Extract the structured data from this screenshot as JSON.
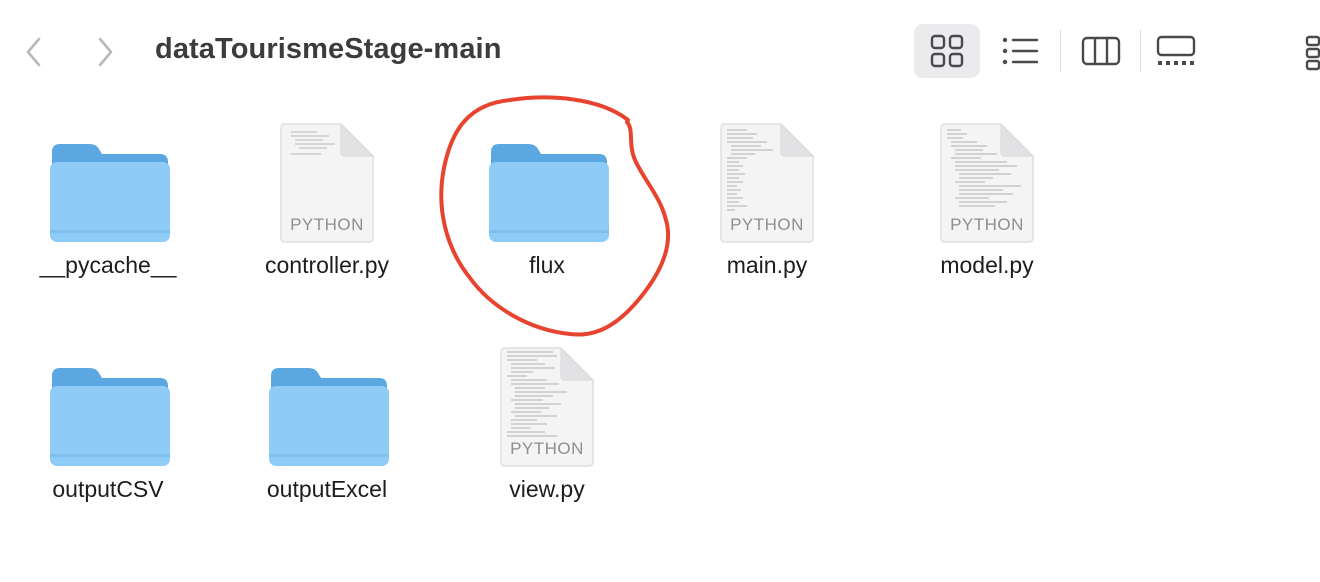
{
  "window": {
    "title": "dataTourismeStage-main"
  },
  "toolbar": {
    "back_icon": "chevron-left-icon",
    "forward_icon": "chevron-right-icon",
    "views": [
      {
        "name": "icons",
        "icon": "grid-icon",
        "selected": true
      },
      {
        "name": "list",
        "icon": "list-icon",
        "selected": false
      },
      {
        "name": "columns",
        "icon": "columns-icon",
        "selected": false
      },
      {
        "name": "gallery",
        "icon": "gallery-icon",
        "selected": false
      },
      {
        "name": "group",
        "icon": "group-icon",
        "selected": false
      }
    ]
  },
  "items": [
    {
      "name": "__pycache__",
      "kind": "folder"
    },
    {
      "name": "controller.py",
      "kind": "python-file",
      "badge": "PYTHON"
    },
    {
      "name": "flux",
      "kind": "folder",
      "annotated": true
    },
    {
      "name": "main.py",
      "kind": "python-file",
      "badge": "PYTHON"
    },
    {
      "name": "model.py",
      "kind": "python-file",
      "badge": "PYTHON"
    },
    {
      "name": "outputCSV",
      "kind": "folder"
    },
    {
      "name": "outputExcel",
      "kind": "folder"
    },
    {
      "name": "view.py",
      "kind": "python-file",
      "badge": "PYTHON"
    }
  ],
  "colors": {
    "folder_front": "#8ecbf6",
    "folder_back": "#5aa7e2",
    "annotation": "#e8432f",
    "selected_view_bg": "#ebebed"
  }
}
